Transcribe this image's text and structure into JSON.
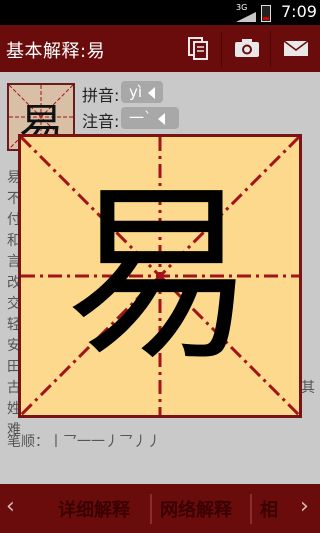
{
  "status_bar": {
    "network": "3G",
    "time": "7:09"
  },
  "header": {
    "title": "基本解释:易",
    "icons": [
      "copy-icon",
      "camera-icon",
      "mail-icon"
    ]
  },
  "entry": {
    "thumbnail_char": "易",
    "pinyin_label": "拼音:",
    "pinyin_value": "yì",
    "zhuyin_label": "注音:",
    "zhuyin_value": "一ˋ"
  },
  "left_column_chars": [
    "易",
    "不",
    "付",
    "和",
    "言",
    "改",
    "交",
    "轻",
    "安",
    "田",
    "古",
    "姓",
    "难"
  ],
  "right_column_chars": [
    "",
    "",
    "",
    "",
    "",
    "",
    "",
    "",
    "",
    "",
    "其",
    "",
    ""
  ],
  "stroke_order": "笔顺：丨乛一一丿乛丿丿",
  "popup": {
    "char": "易",
    "colors": {
      "background": "#fdd98d",
      "grid": "#a3131b"
    }
  },
  "bottom_tabs": [
    "详细解释",
    "网络解释",
    "相"
  ],
  "colors": {
    "brand": "#6b0c0c"
  }
}
